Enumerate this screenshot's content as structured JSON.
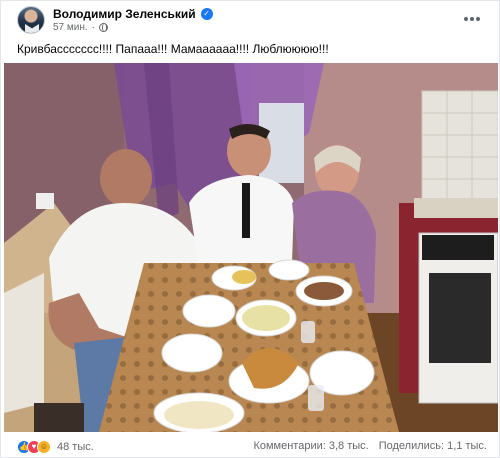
{
  "post": {
    "author": "Володимир Зеленський",
    "time": "57 мин.",
    "caption": "Кривбассссссс!!!! Папааа!!! Мамаааааа!!!! Люблюююю!!!"
  },
  "photo": {
    "description": ""
  },
  "footer": {
    "reactions_count": "48 тыс.",
    "comments": "Комментарии: 3,8 тыс.",
    "shares": "Поделились: 1,1 тыс."
  },
  "icons": {
    "verified": "verified-badge-icon",
    "privacy": "globe-icon",
    "more": "more-options-icon",
    "reactions": [
      "like-icon",
      "love-icon",
      "haha-icon"
    ]
  },
  "colors": {
    "accent": "#1877f2",
    "love": "#f33e58",
    "haha": "#f7b125",
    "text_secondary": "#65676b"
  }
}
